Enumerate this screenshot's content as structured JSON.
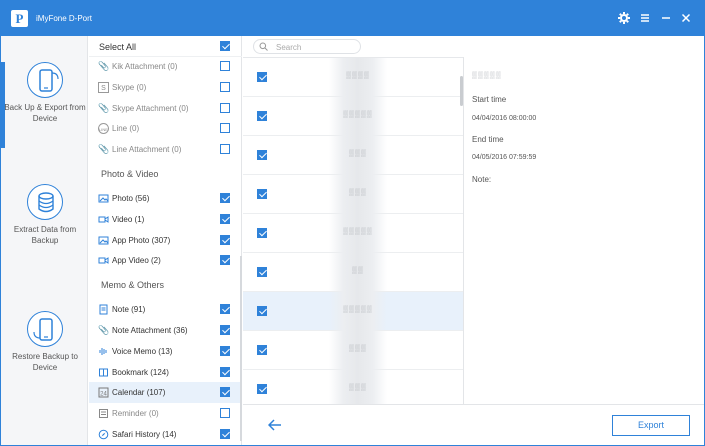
{
  "app": {
    "title": "iMyFone D-Port",
    "logo_letter": "P"
  },
  "titlebar": {
    "settings_icon": "gear-icon",
    "menu_icon": "menu-icon",
    "minimize_icon": "minimize-icon",
    "close_icon": "close-icon"
  },
  "nav": {
    "items": [
      {
        "label": "Back Up & Export from Device",
        "icon": "phone-backup-icon",
        "active": true
      },
      {
        "label": "Extract Data from Backup",
        "icon": "database-icon",
        "active": false
      },
      {
        "label": "Restore Backup to Device",
        "icon": "phone-restore-icon",
        "active": false
      }
    ]
  },
  "categories": {
    "select_all": {
      "label": "Select All",
      "checked": true
    },
    "top_items": [
      {
        "label": "Kik Attachment (0)",
        "icon": "paperclip-icon",
        "checked": false
      },
      {
        "label": "Skype (0)",
        "icon": "skype-icon",
        "checked": false
      },
      {
        "label": "Skype Attachment (0)",
        "icon": "paperclip-icon",
        "checked": false
      },
      {
        "label": "Line (0)",
        "icon": "line-icon",
        "checked": false
      },
      {
        "label": "Line Attachment (0)",
        "icon": "paperclip-icon",
        "checked": false
      }
    ],
    "photo_video": {
      "title": "Photo & Video",
      "items": [
        {
          "label": "Photo (56)",
          "icon": "image-icon",
          "checked": true
        },
        {
          "label": "Video (1)",
          "icon": "video-icon",
          "checked": true
        },
        {
          "label": "App Photo (307)",
          "icon": "image-icon",
          "checked": true
        },
        {
          "label": "App Video (2)",
          "icon": "video-icon",
          "checked": true
        }
      ]
    },
    "memo_others": {
      "title": "Memo & Others",
      "items": [
        {
          "label": "Note (91)",
          "icon": "note-icon",
          "checked": true
        },
        {
          "label": "Note Attachment (36)",
          "icon": "paperclip-icon",
          "checked": true
        },
        {
          "label": "Voice Memo (13)",
          "icon": "voice-memo-icon",
          "checked": true
        },
        {
          "label": "Bookmark (124)",
          "icon": "book-icon",
          "checked": true
        },
        {
          "label": "Calendar (107)",
          "icon": "calendar-icon",
          "checked": true,
          "selected": true
        },
        {
          "label": "Reminder (0)",
          "icon": "reminder-icon",
          "checked": false
        },
        {
          "label": "Safari History (14)",
          "icon": "compass-icon",
          "checked": true
        }
      ]
    }
  },
  "list": {
    "search_placeholder": "Search",
    "rows": [
      {
        "checked": true,
        "text": "▒▒▒▒",
        "selected": false
      },
      {
        "checked": true,
        "text": "▒▒▒▒▒",
        "selected": false
      },
      {
        "checked": true,
        "text": "▒▒▒",
        "selected": false
      },
      {
        "checked": true,
        "text": "▒▒▒",
        "selected": false
      },
      {
        "checked": true,
        "text": "▒▒▒▒▒",
        "selected": false
      },
      {
        "checked": true,
        "text": "▒▒",
        "selected": false
      },
      {
        "checked": true,
        "text": "▒▒▒▒▒",
        "selected": true
      },
      {
        "checked": true,
        "text": "▒▒▒",
        "selected": false
      },
      {
        "checked": true,
        "text": "▒▒▒",
        "selected": false
      }
    ]
  },
  "detail": {
    "title": "▒▒▒▒▒",
    "start_label": "Start time",
    "start_value": "04/04/2016 08:00:00",
    "end_label": "End time",
    "end_value": "04/05/2016 07:59:59",
    "note_label": "Note:"
  },
  "footer": {
    "back_icon": "back-arrow-icon",
    "export_label": "Export"
  },
  "colors": {
    "accent": "#2f82d9",
    "selected_bg": "#e8f1fb"
  }
}
